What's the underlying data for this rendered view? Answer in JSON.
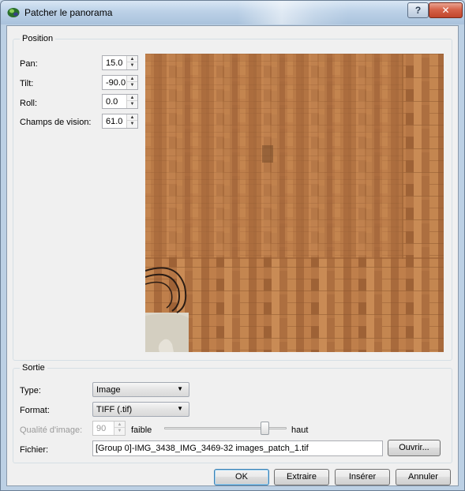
{
  "window": {
    "title": "Patcher le panorama",
    "help_button": "?",
    "close_button": "✕"
  },
  "position": {
    "group_title": "Position",
    "pan": {
      "label": "Pan:",
      "value": "15.0"
    },
    "tilt": {
      "label": "Tilt:",
      "value": "-90.0"
    },
    "roll": {
      "label": "Roll:",
      "value": "0.0"
    },
    "fov": {
      "label": "Champs de vision:",
      "value": "61.0"
    }
  },
  "output": {
    "group_title": "Sortie",
    "type": {
      "label": "Type:",
      "value": "Image"
    },
    "format": {
      "label": "Format:",
      "value": "TIFF (.tif)"
    },
    "quality": {
      "label": "Qualité d'image:",
      "value": "90",
      "low": "faible",
      "high": "haut",
      "slider_fraction": 0.85
    },
    "file": {
      "label": "Fichier:",
      "value": "[Group 0]-IMG_3438_IMG_3469-32 images_patch_1.tif",
      "browse": "Ouvrir..."
    }
  },
  "buttons": {
    "ok": "OK",
    "extract": "Extraire",
    "insert": "Insérer",
    "cancel": "Annuler"
  },
  "icons": {
    "spin_up": "▲",
    "spin_down": "▼",
    "combo_arrow": "▼"
  }
}
